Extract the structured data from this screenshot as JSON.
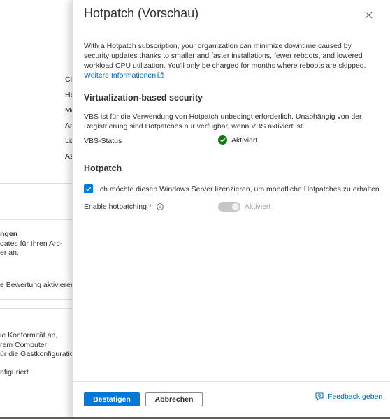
{
  "background": {
    "labels": [
      "Cl",
      "He",
      "Mo",
      "Ar",
      "Liz",
      "Az"
    ],
    "update_section": {
      "title": "ngen",
      "lines": [
        "dates für Ihren Arc-",
        "er an."
      ]
    },
    "assessment_text": "e Bewertung aktivieren",
    "compliance_lines": [
      "ie Konformität an,",
      "rem Computer",
      "ür die Gastkonfiguration"
    ],
    "configured_text": "nfiguriert"
  },
  "blade": {
    "title": "Hotpatch (Vorschau)",
    "intro_text": "With a Hotpatch subscription, your organization can minimize downtime caused by security updates thanks to smaller and faster installations, fewer reboots, and lowered workload CPU utilization. You'll only be charged for months where reboots are skipped. ",
    "intro_link": "Weitere Informationen",
    "vbs": {
      "title": "Virtualization-based security",
      "description": "VBS ist für die Verwendung von Hotpatch unbedingt erforderlich. Unabhängig von der Registrierung sind Hotpatches nur verfügbar, wenn VBS aktiviert ist.",
      "status_label": "VBS-Status",
      "status_value": "Aktiviert"
    },
    "hotpatch": {
      "title": "Hotpatch",
      "checkbox_label": "Ich möchte diesen Windows Server lizenzieren, um monatliche Hotpatches zu erhalten.",
      "checkbox_checked": true,
      "enable_label": "Enable hotpatching",
      "required_marker": "*",
      "toggle_value": "Aktiviert"
    },
    "footer": {
      "confirm_label": "Bestätigen",
      "cancel_label": "Abbrechen",
      "feedback_label": "Feedback geben"
    }
  },
  "colors": {
    "accent": "#0078d4",
    "link": "#0067b8",
    "success": "#107c10"
  }
}
